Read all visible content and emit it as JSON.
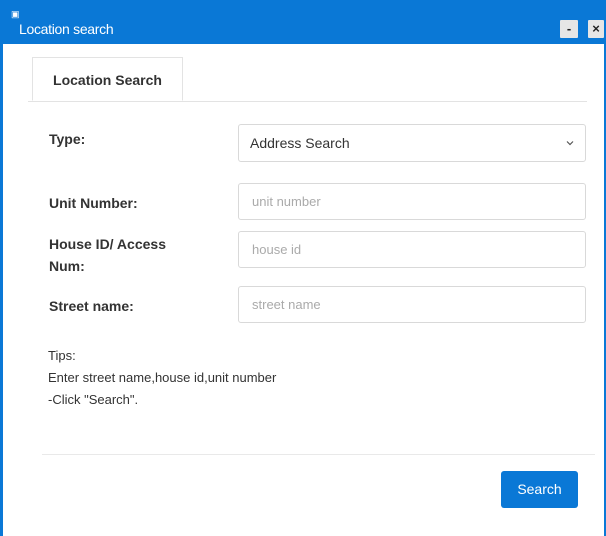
{
  "window": {
    "title": "Location search",
    "title_icon": "app-icon",
    "minimize_label": "-",
    "close_label": "×",
    "accent_color": "#0a78d6"
  },
  "tabs": [
    {
      "label": "Location Search",
      "active": true
    }
  ],
  "form": {
    "type": {
      "label": "Type:",
      "value": "Address Search"
    },
    "unit_number": {
      "label": "Unit Number:",
      "placeholder": "unit number",
      "value": ""
    },
    "house_id": {
      "label_line1": "House ID/ Access",
      "label_line2": "Num:",
      "placeholder": "house id",
      "value": ""
    },
    "street_name": {
      "label": "Street name:",
      "placeholder": "street name",
      "value": ""
    }
  },
  "tips": {
    "heading": "Tips:",
    "line1": "Enter street name,house id,unit number",
    "line2": "-Click \"Search\"."
  },
  "actions": {
    "search_label": "Search"
  }
}
